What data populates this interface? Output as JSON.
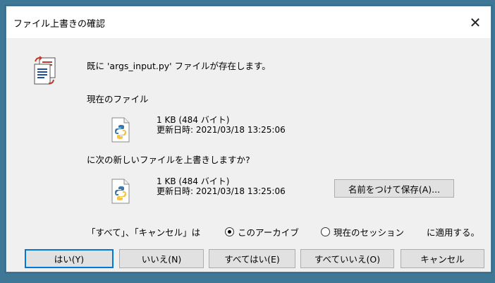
{
  "window": {
    "title": "ファイル上書きの確認",
    "close_glyph": "✕"
  },
  "message": {
    "exists": "既に 'args_input.py' ファイルが存在します。",
    "current_label": "現在のファイル",
    "question": "に次の新しいファイルを上書きしますか?"
  },
  "current_file": {
    "size": "1 KB (484 バイト)",
    "modified": "更新日時: 2021/03/18 13:25:06"
  },
  "new_file": {
    "size": "1 KB (484 バイト)",
    "modified": "更新日時: 2021/03/18 13:25:06"
  },
  "save_as_button": "名前をつけて保存(A)...",
  "apply_scope": {
    "prefix": "「すべて」、「キャンセル」は",
    "option_archive": "このアーカイブ",
    "option_session": "現在のセッション",
    "suffix": "に適用する。",
    "selected": "archive"
  },
  "buttons": {
    "yes": "はい(Y)",
    "no": "いいえ(N)",
    "yes_all": "すべてはい(E)",
    "no_all": "すべていいえ(O)",
    "cancel": "キャンセル"
  },
  "colors": {
    "desktop": "#3f7896",
    "dialog_bg": "#f0f0f0",
    "accent": "#0078d7"
  },
  "icons": {
    "dialog": "file-replace-icon",
    "file": "python-file-icon"
  }
}
